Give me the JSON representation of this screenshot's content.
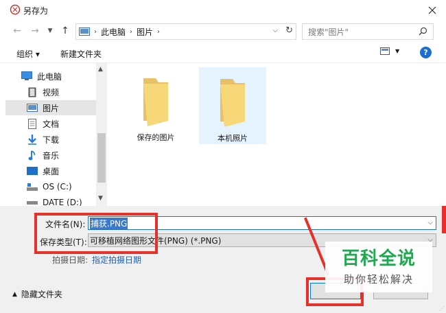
{
  "window": {
    "title": "另存为"
  },
  "nav": {
    "breadcrumbs": [
      "此电脑",
      "图片"
    ],
    "search_placeholder": "搜索\"图片\""
  },
  "toolbar": {
    "organize": "组织 ▾",
    "new_folder": "新建文件夹"
  },
  "sidebar": {
    "items": [
      {
        "label": "此电脑",
        "icon": "computer-icon"
      },
      {
        "label": "视频",
        "icon": "video-icon"
      },
      {
        "label": "图片",
        "icon": "pictures-icon",
        "selected": true
      },
      {
        "label": "文档",
        "icon": "document-icon"
      },
      {
        "label": "下载",
        "icon": "download-icon"
      },
      {
        "label": "音乐",
        "icon": "music-icon"
      },
      {
        "label": "桌面",
        "icon": "desktop-icon"
      },
      {
        "label": "OS (C:)",
        "icon": "drive-icon"
      },
      {
        "label": "DATE (D:)",
        "icon": "drive-icon"
      }
    ]
  },
  "folders": [
    {
      "label": "保存的图片"
    },
    {
      "label": "本机照片"
    }
  ],
  "form": {
    "filename_label": "文件名(N):",
    "filename_value": "捕获.PNG",
    "filetype_label": "保存类型(T):",
    "filetype_value": "可移植网络图形文件(PNG) (*.PNG)",
    "date_label": "拍摄日期:",
    "date_link": "指定拍摄日期"
  },
  "footer": {
    "hide_folders": "隐藏文件夹"
  },
  "watermark": {
    "main": "百科全说",
    "sub": "助你轻松解决"
  },
  "colors": {
    "accent": "#1a6fd1",
    "highlight": "#e8302a",
    "watermark": "#1fa84f"
  }
}
